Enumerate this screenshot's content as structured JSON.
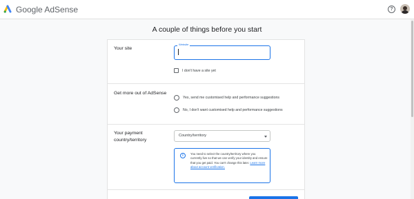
{
  "header": {
    "brand_google": "Google",
    "brand_product": "AdSense",
    "help_icon_glyph": "?",
    "logo_icon": "adsense-logo-icon",
    "accent_colors": [
      "#FBBC04",
      "#34A853",
      "#4285F4"
    ]
  },
  "page": {
    "title": "A couple of things before you start"
  },
  "site_section": {
    "label": "Your site",
    "input_legend": "Website",
    "input_value": "",
    "checkbox_label": "I don't have a site yet"
  },
  "help_section": {
    "label": "Get more out of AdSense",
    "options": [
      "Yes, send me customised help and performance suggestions",
      "No, I don't want customised help and performance suggestions"
    ]
  },
  "country_section": {
    "label_line1": "Your payment",
    "label_line2": "country/territory",
    "select_value": "Country/territory",
    "info_text": "You need to select the country/territory where you currently live so that we can verify your identity and ensure that you get paid. You can't change this later. ",
    "info_link": "Learn more about account verification.",
    "info_icon_glyph": "i"
  },
  "colors": {
    "accent": "#1a73e8",
    "background": "#f8f9fa"
  }
}
